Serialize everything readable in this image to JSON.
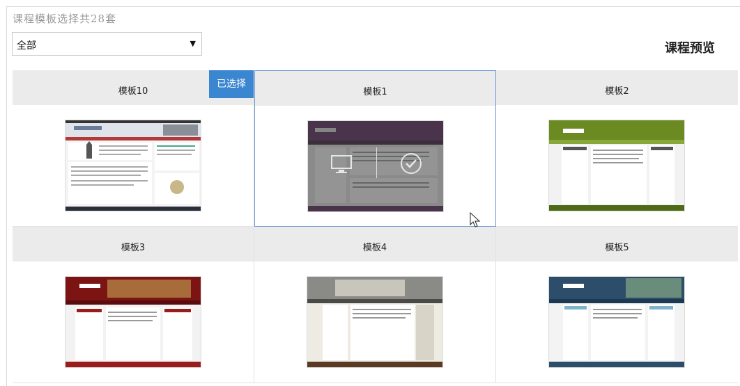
{
  "header": {
    "count_title": "课程模板选择共28套",
    "preview_title": "课程预览"
  },
  "filter": {
    "selected": "全部"
  },
  "templates": [
    {
      "name": "模板10",
      "badge": "已选择"
    },
    {
      "name": "模板1"
    },
    {
      "name": "模板2"
    },
    {
      "name": "模板3"
    },
    {
      "name": "模板4"
    },
    {
      "name": "模板5"
    }
  ],
  "colors": {
    "accent": "#3b86d0",
    "selected_border": "#6f9bd1"
  }
}
